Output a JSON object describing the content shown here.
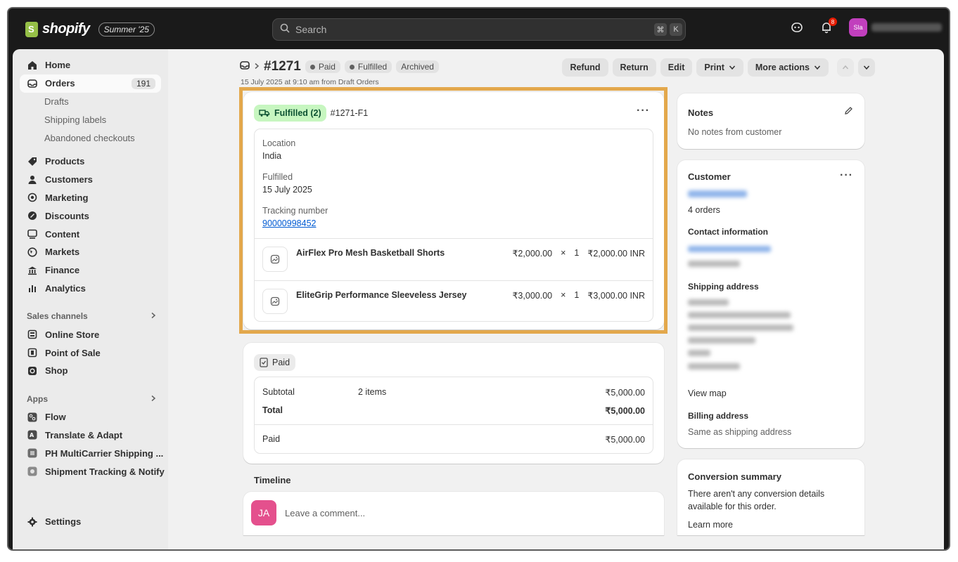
{
  "topbar": {
    "brand": "shopify",
    "edition": "Summer '25",
    "search_placeholder": "Search",
    "shortcut_keys": [
      "⌘",
      "K"
    ],
    "notification_count": "8",
    "avatar_initials": "Sla"
  },
  "sidebar": {
    "home": "Home",
    "orders": "Orders",
    "orders_count": "191",
    "orders_sub": [
      "Drafts",
      "Shipping labels",
      "Abandoned checkouts"
    ],
    "main_items": [
      "Products",
      "Customers",
      "Marketing",
      "Discounts",
      "Content",
      "Markets",
      "Finance",
      "Analytics"
    ],
    "sales_channels_label": "Sales channels",
    "sales_channels": [
      "Online Store",
      "Point of Sale",
      "Shop"
    ],
    "apps_label": "Apps",
    "apps": [
      "Flow",
      "Translate & Adapt",
      "PH MultiCarrier Shipping ...",
      "Shipment Tracking & Notify"
    ],
    "settings": "Settings"
  },
  "order": {
    "number": "#1271",
    "badges": [
      "Paid",
      "Fulfilled",
      "Archived"
    ],
    "subtitle": "15 July 2025 at 9:10 am from Draft Orders",
    "actions": {
      "refund": "Refund",
      "return": "Return",
      "edit": "Edit",
      "print": "Print",
      "more": "More actions"
    }
  },
  "fulfillment": {
    "status": "Fulfilled (2)",
    "id": "#1271-F1",
    "location_label": "Location",
    "location": "India",
    "fulfilled_label": "Fulfilled",
    "fulfilled_date": "15 July 2025",
    "tracking_label": "Tracking number",
    "tracking_number": "90000998452",
    "items": [
      {
        "name": "AirFlex Pro Mesh Basketball Shorts",
        "price": "₹2,000.00",
        "times": "×",
        "qty": "1",
        "total": "₹2,000.00 INR"
      },
      {
        "name": "EliteGrip Performance Sleeveless Jersey",
        "price": "₹3,000.00",
        "times": "×",
        "qty": "1",
        "total": "₹3,000.00 INR"
      }
    ]
  },
  "payment": {
    "status": "Paid",
    "subtotal_label": "Subtotal",
    "subtotal_items": "2 items",
    "subtotal": "₹5,000.00",
    "total_label": "Total",
    "total": "₹5,000.00",
    "paid_label": "Paid",
    "paid": "₹5,000.00"
  },
  "timeline": {
    "title": "Timeline",
    "avatar": "JA",
    "comment_placeholder": "Leave a comment..."
  },
  "notes": {
    "title": "Notes",
    "text": "No notes from customer"
  },
  "customer": {
    "title": "Customer",
    "orders_link": "4 orders",
    "contact_title": "Contact information",
    "shipping_title": "Shipping address",
    "view_map": "View map",
    "billing_title": "Billing address",
    "billing_text": "Same as shipping address"
  },
  "conversion": {
    "title": "Conversion summary",
    "text_line1": "There aren't any conversion details",
    "text_line2": "available for this order.",
    "learn_more": "Learn more"
  },
  "colors": {
    "highlight": "#e3a84c",
    "fulfilled_bg": "#c7f6c0",
    "link": "#005bd3",
    "avatar_ja": "#e4508d",
    "avatar_store": "#c13fbd"
  }
}
